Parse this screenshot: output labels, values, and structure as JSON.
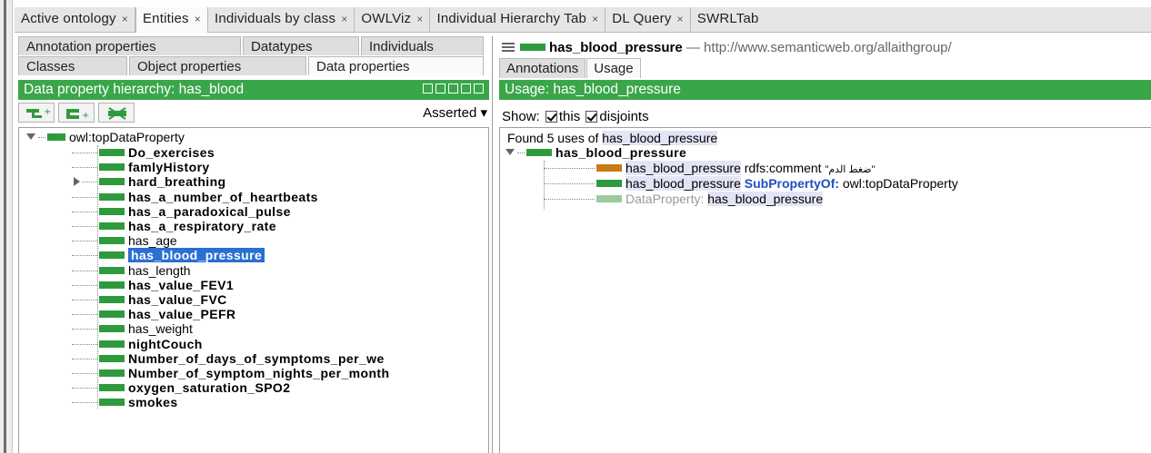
{
  "top_tabs": [
    {
      "label": "Active ontology",
      "close": "×"
    },
    {
      "label": "Entities",
      "close": "×"
    },
    {
      "label": "Individuals by class",
      "close": "×"
    },
    {
      "label": "OWLViz",
      "close": "×"
    },
    {
      "label": "Individual Hierarchy Tab",
      "close": "×"
    },
    {
      "label": "DL Query",
      "close": "×"
    },
    {
      "label": "SWRLTab",
      "close": ""
    }
  ],
  "left_tabs_row1": [
    "Annotation properties",
    "Datatypes",
    "Individuals"
  ],
  "left_tabs_row2": [
    "Classes",
    "Object properties",
    "Data properties"
  ],
  "left_header": "Data property hierarchy: has_blood",
  "asserted_label": "Asserted",
  "asserted_arrow": "▾",
  "tree": {
    "root": "owl:topDataProperty",
    "items": [
      "Do_exercises",
      "famlyHistory",
      "hard_breathing",
      "has_a_number_of_heartbeats",
      "has_a_paradoxical_pulse",
      "has_a_respiratory_rate",
      "has_age",
      "has_blood_pressure",
      "has_length",
      "has_value_FEV1",
      "has_value_FVC",
      "has_value_PEFR",
      "has_weight",
      "nightCouch",
      "Number_of_days_of_symptoms_per_we",
      "Number_of_symptom_nights_per_month",
      "oxygen_saturation_SPO2",
      "smokes"
    ]
  },
  "right": {
    "title_name": "has_blood_pressure",
    "title_sub": "— http://www.semanticweb.org/allaithgroup/",
    "tabs": [
      "Annotations",
      "Usage"
    ],
    "header": "Usage: has_blood_pressure",
    "show_label": "Show:",
    "show_this": "this",
    "show_disjoints": "disjoints",
    "found_prefix": "Found 5 uses of",
    "found_name": "has_blood_pressure",
    "usage_root": "has_blood_pressure",
    "line1_subject": "has_blood_pressure",
    "line1_predicate": "rdfs:comment",
    "line1_value": "\"ضغط الدم\"",
    "line2_subject": "has_blood_pressure",
    "line2_keyword": "SubPropertyOf:",
    "line2_object": "owl:topDataProperty",
    "line3_keyword": "DataProperty:",
    "line3_object": "has_blood_pressure"
  },
  "colors": {
    "header_green": "#3aa64a",
    "property_green": "#2f9a3d",
    "annotation_orange": "#cc7a12",
    "selection_blue": "#2a6fd3"
  }
}
